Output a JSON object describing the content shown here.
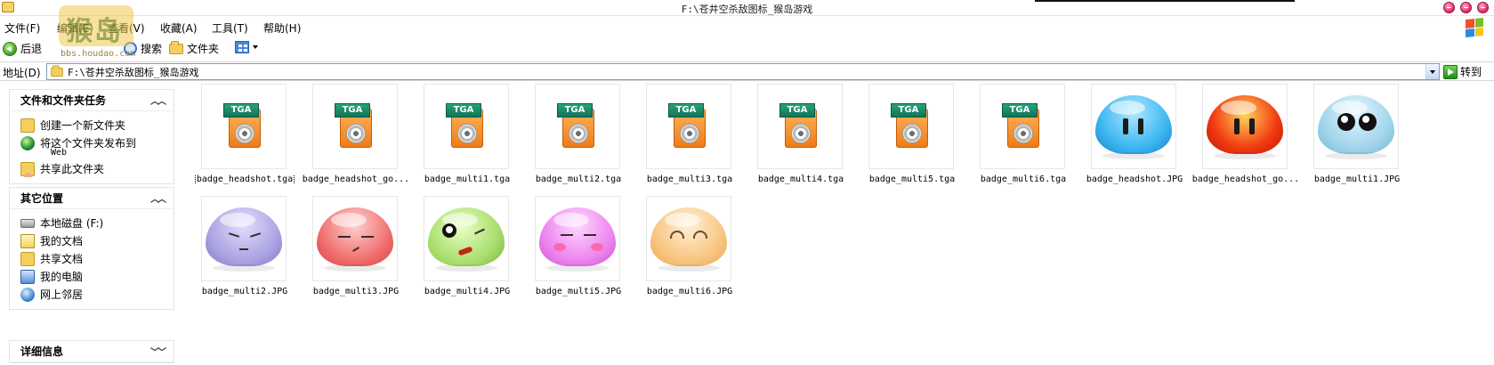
{
  "window": {
    "title": "F:\\苍井空杀敌图标_猴岛游戏"
  },
  "watermark": {
    "text": "猴岛",
    "url": "bbs.houdao.com"
  },
  "menu": [
    "文件(F)",
    "编辑(E)",
    "查看(V)",
    "收藏(A)",
    "工具(T)",
    "帮助(H)"
  ],
  "toolbar": {
    "back": "后退",
    "search": "搜索",
    "folders": "文件夹"
  },
  "address": {
    "label": "地址(D)",
    "value": "F:\\苍井空杀敌图标_猴岛游戏",
    "go": "转到"
  },
  "taskpane": {
    "file_tasks": {
      "title": "文件和文件夹任务",
      "items": [
        "创建一个新文件夹",
        "将这个文件夹发布到",
        "共享此文件夹"
      ],
      "publish_sub": "Web"
    },
    "other_places": {
      "title": "其它位置",
      "items": [
        "本地磁盘 (F:)",
        "我的文档",
        "共享文档",
        "我的电脑",
        "网上邻居"
      ]
    },
    "details": {
      "title": "详细信息"
    }
  },
  "files": [
    {
      "name": "badge_headshot.tga",
      "type": "tga",
      "selected": true
    },
    {
      "name": "badge_headshot_go...",
      "type": "tga"
    },
    {
      "name": "badge_multi1.tga",
      "type": "tga"
    },
    {
      "name": "badge_multi2.tga",
      "type": "tga"
    },
    {
      "name": "badge_multi3.tga",
      "type": "tga"
    },
    {
      "name": "badge_multi4.tga",
      "type": "tga"
    },
    {
      "name": "badge_multi5.tga",
      "type": "tga"
    },
    {
      "name": "badge_multi6.tga",
      "type": "tga"
    },
    {
      "name": "badge_headshot.JPG",
      "type": "jpg",
      "color": "#3fb8f2"
    },
    {
      "name": "badge_headshot_go...",
      "type": "jpg",
      "color": "#f23a12"
    },
    {
      "name": "badge_multi1.JPG",
      "type": "jpg",
      "color": "#9fd3ea"
    },
    {
      "name": "badge_multi2.JPG",
      "type": "jpg",
      "color": "#a9a2e0"
    },
    {
      "name": "badge_multi3.JPG",
      "type": "jpg",
      "color": "#f06b6b"
    },
    {
      "name": "badge_multi4.JPG",
      "type": "jpg",
      "color": "#a6dc6a"
    },
    {
      "name": "badge_multi5.JPG",
      "type": "jpg",
      "color": "#ec82ee"
    },
    {
      "name": "badge_multi6.JPG",
      "type": "jpg",
      "color": "#f8c47e"
    }
  ],
  "tga_tag": "TGA"
}
